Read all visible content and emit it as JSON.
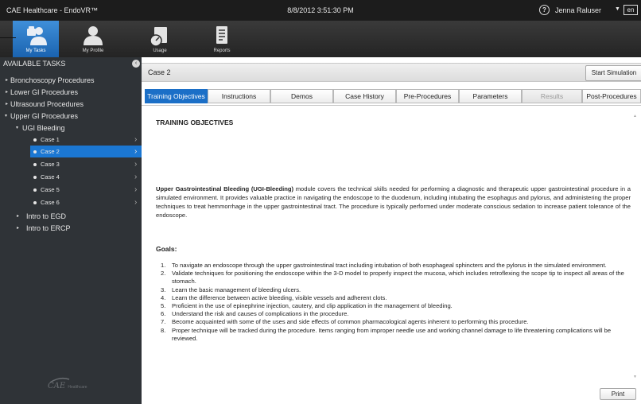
{
  "window": {
    "app_title": "CAE Healthcare - EndoVR™",
    "datetime": "8/8/2012 3:51:30 PM",
    "help_icon": "?",
    "user_name": "Jenna Raluser",
    "user_caret": "▼",
    "language": "en"
  },
  "topnav": {
    "items": [
      {
        "label": "My Tasks",
        "icon": "my-tasks-icon",
        "active": true
      },
      {
        "label": "My Profile",
        "icon": "my-profile-icon",
        "active": false
      },
      {
        "label": "Usage",
        "icon": "usage-icon",
        "active": false
      },
      {
        "label": "Reports",
        "icon": "reports-icon",
        "active": false
      }
    ]
  },
  "sidebar": {
    "heading": "AVAILABLE TASKS",
    "collapse_icon": "‹",
    "tree": [
      {
        "label": "Bronchoscopy Procedures",
        "expanded": false
      },
      {
        "label": "Lower GI Procedures",
        "expanded": false
      },
      {
        "label": "Ultrasound Procedures",
        "expanded": false
      },
      {
        "label": "Upper GI Procedures",
        "expanded": true
      },
      {
        "label": "UGI Bleeding",
        "expanded": true
      },
      {
        "label": "Intro to EGD",
        "expanded": false
      },
      {
        "label": "Intro to ERCP",
        "expanded": false
      }
    ],
    "cases": [
      {
        "label": "Case 1",
        "selected": false
      },
      {
        "label": "Case 2",
        "selected": true
      },
      {
        "label": "Case 3",
        "selected": false
      },
      {
        "label": "Case 4",
        "selected": false
      },
      {
        "label": "Case 5",
        "selected": false
      },
      {
        "label": "Case 6",
        "selected": false
      }
    ],
    "logo": "CAE",
    "logo_sub": "Healthcare"
  },
  "main": {
    "case_title": "Case 2",
    "start_button": "Start Simulation",
    "tabs": [
      {
        "label": "Training Objectives",
        "state": "active"
      },
      {
        "label": "Instructions",
        "state": "normal"
      },
      {
        "label": "Demos",
        "state": "normal"
      },
      {
        "label": "Case History",
        "state": "normal"
      },
      {
        "label": "Pre-Procedures",
        "state": "normal"
      },
      {
        "label": "Parameters",
        "state": "normal"
      },
      {
        "label": "Results",
        "state": "disabled"
      },
      {
        "label": "Post-Procedures",
        "state": "normal"
      }
    ],
    "section_title": "TRAINING OBJECTIVES",
    "intro_bold": "Upper Gastrointestinal Bleeding (UGI-Bleeding)",
    "intro_rest": " module covers the technical skills needed for performing a diagnostic and therapeutic upper gastrointestinal procedure in a simulated environment.  It provides valuable practice in navigating the endoscope to the duodenum, including intubating the esophagus and pylorus, and administering the proper techniques to treat hemmorrhage in the upper gastrointestinal tract. The procedure is typically performed under moderate conscious sedation to increase patient tolerance of the endoscope.",
    "goals_title": "Goals:",
    "goals": [
      "To navigate an endoscope through the upper gastrointestinal tract including intubation of both esophageal sphincters and the pylorus in the simulated environment.",
      "Validate techniques for positioning the endoscope within the 3-D model to properly inspect the mucosa, which includes retroflexing the scope tip to inspect all areas of the stomach.",
      "Learn the basic management of bleeding ulcers.",
      "Learn the difference between active bleeding, visible vessels and adherent clots.",
      "Proficient in the use of epinephrine injection, cautery, and clip application in the management of bleeding.",
      "Understand the risk and causes of complications in the procedure.",
      "Become acquainted with some of the uses and side effects of common pharmacological agents inherent to performing this procedure.",
      "Proper technique will be tracked during the procedure. Items ranging from improper needle use and working channel damage to life threatening complications will be reviewed."
    ],
    "print_button": "Print",
    "scroll_up": "▲",
    "scroll_down": "▼"
  }
}
